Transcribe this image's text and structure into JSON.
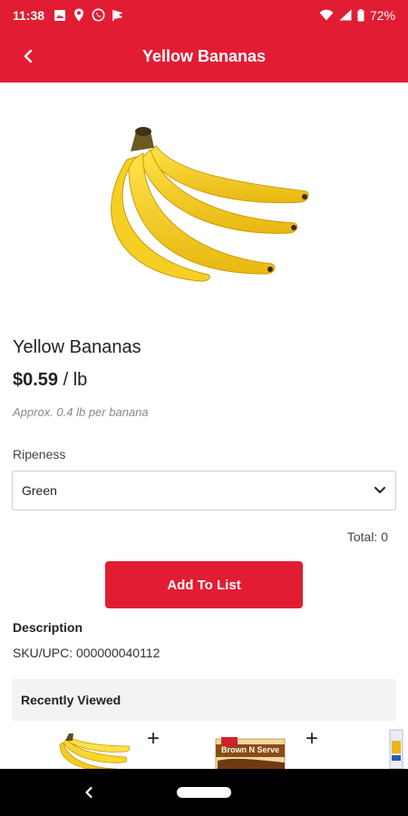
{
  "status_bar": {
    "time": "11:38",
    "battery": "72%"
  },
  "app_bar": {
    "title": "Yellow Bananas"
  },
  "product": {
    "name": "Yellow Bananas",
    "price": "$0.59",
    "price_unit": " / lb",
    "approx_note": "Approx. 0.4 lb per banana"
  },
  "ripeness": {
    "label": "Ripeness",
    "selected": "Green"
  },
  "total_text": "Total: 0",
  "add_button_label": "Add To List",
  "description": {
    "title": "Description",
    "sku_text": "SKU/UPC: 000000040112"
  },
  "recently_viewed": {
    "title": "Recently Viewed",
    "item_2_label": "Brown N Serve"
  },
  "colors": {
    "brand_red": "#e21d33"
  }
}
